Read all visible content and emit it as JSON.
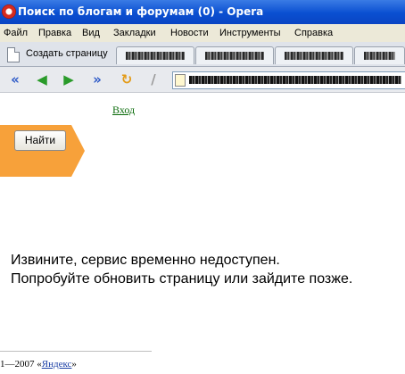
{
  "window": {
    "title": "Поиск по блогам и форумам (0) - Opera"
  },
  "menu": [
    "Файл",
    "Правка",
    "Вид",
    "Закладки",
    "Новости",
    "Инструменты",
    "Справка"
  ],
  "tabs": {
    "new_page": "Создать страницу"
  },
  "toolbar": {
    "icons": [
      "back-double-icon",
      "back-icon",
      "forward-icon",
      "forward-double-icon",
      "reload-icon",
      "edit-icon"
    ]
  },
  "page": {
    "login": "Вход",
    "find_button": "Найти",
    "error_line1": "Извините, сервис временно недоступен.",
    "error_line2": "Попробуйте обновить страницу или зайдите позже.",
    "footer_prefix": "1—2007 «",
    "footer_link": "Яндекс",
    "footer_suffix": "»"
  }
}
